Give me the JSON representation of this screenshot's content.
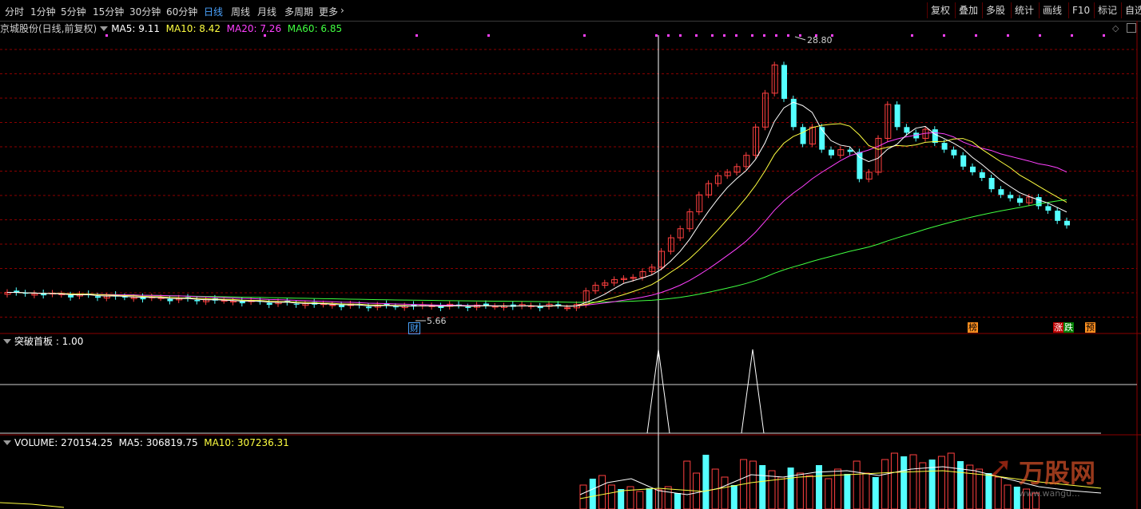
{
  "toolbar": {
    "periods": [
      "分时",
      "1分钟",
      "5分钟",
      "15分钟",
      "30分钟",
      "60分钟",
      "日线",
      "周线",
      "月线",
      "多周期",
      "更多"
    ],
    "active_period": "日线",
    "right_buttons": [
      "复权",
      "叠加",
      "多股",
      "统计",
      "画线",
      "F10",
      "标记",
      "自选"
    ]
  },
  "main_panel": {
    "stock_title": "京城股份(日线,前复权)",
    "ma5_label": "MA5: 9.11",
    "ma10_label": "MA10: 8.42",
    "ma20_label": "MA20: 7.26",
    "ma60_label": "MA60: 6.85",
    "high_label": "28.80",
    "low_label": "5.66",
    "badges": [
      "财",
      "榜",
      "涨",
      "跌",
      "预"
    ]
  },
  "indicator_panel": {
    "title": "突破首板 : 1.00"
  },
  "volume_panel": {
    "title": "VOLUME: 270154.25",
    "ma5_label": "MA5: 306819.75",
    "ma10_label": "MA10: 307236.31"
  },
  "watermark": {
    "text": "万股网",
    "url": "www.wangu..."
  },
  "colors": {
    "up": "#ff4040",
    "down": "#54ffff",
    "ma5": "#ffffff",
    "ma10": "#ffff40",
    "ma20": "#ff40ff",
    "ma60": "#40ff40",
    "grid": "#8b0000"
  },
  "chart_data": {
    "type": "candlestick",
    "title": "京城股份(日线,前复权)",
    "price_range": [
      5.0,
      30.0
    ],
    "annotated_high": 28.8,
    "annotated_low": 5.66,
    "last_moving_averages": {
      "MA5": 9.11,
      "MA10": 8.42,
      "MA20": 7.26,
      "MA60": 6.85
    },
    "indicator": {
      "name": "突破首板",
      "value": 1.0
    },
    "volume": {
      "last": 270154.25,
      "MA5": 306819.75,
      "MA10": 307236.31
    }
  }
}
